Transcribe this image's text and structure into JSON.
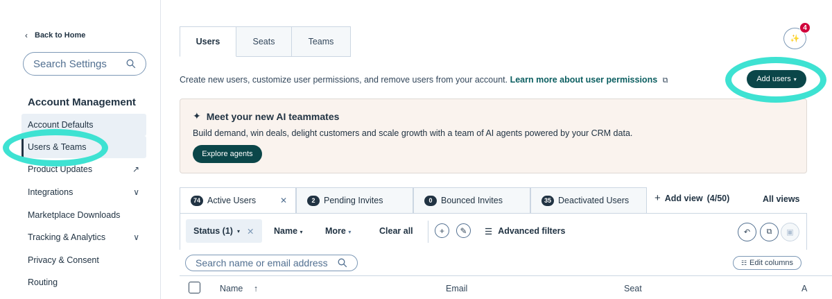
{
  "sidebar": {
    "back_label": "Back to Home",
    "search_placeholder": "Search Settings",
    "section_title": "Account Management",
    "items": [
      {
        "label": "Account Defaults"
      },
      {
        "label": "Users & Teams"
      },
      {
        "label": "Product Updates"
      },
      {
        "label": "Integrations"
      },
      {
        "label": "Marketplace Downloads"
      },
      {
        "label": "Tracking & Analytics"
      },
      {
        "label": "Privacy & Consent"
      },
      {
        "label": "Routing"
      }
    ]
  },
  "tabs": [
    {
      "label": "Users"
    },
    {
      "label": "Seats"
    },
    {
      "label": "Teams"
    }
  ],
  "notifications": {
    "count": "4"
  },
  "description": {
    "text": "Create new users, customize user permissions, and remove users from your account.",
    "link": "Learn more about user permissions"
  },
  "add_users_label": "Add users",
  "banner": {
    "title": "Meet your new AI teammates",
    "text": "Build demand, win deals, delight customers and scale growth with a team of AI agents powered by your CRM data.",
    "button": "Explore agents"
  },
  "views": [
    {
      "count": "74",
      "label": "Active Users"
    },
    {
      "count": "2",
      "label": "Pending Invites"
    },
    {
      "count": "0",
      "label": "Bounced Invites"
    },
    {
      "count": "35",
      "label": "Deactivated Users"
    }
  ],
  "add_view": {
    "label": "Add view",
    "count": "(4/50)"
  },
  "all_views_label": "All views",
  "filters": {
    "status": "Status (1)",
    "name": "Name",
    "more": "More",
    "clear_all": "Clear all",
    "advanced": "Advanced filters"
  },
  "table": {
    "search_placeholder": "Search name or email address",
    "edit_columns": "Edit columns",
    "columns": [
      "Name",
      "Email",
      "Seat",
      "A"
    ]
  },
  "colors": {
    "accent_dark_teal": "#0b4649",
    "highlight_ring": "#3ee2d2",
    "badge_red": "#d0033b"
  }
}
